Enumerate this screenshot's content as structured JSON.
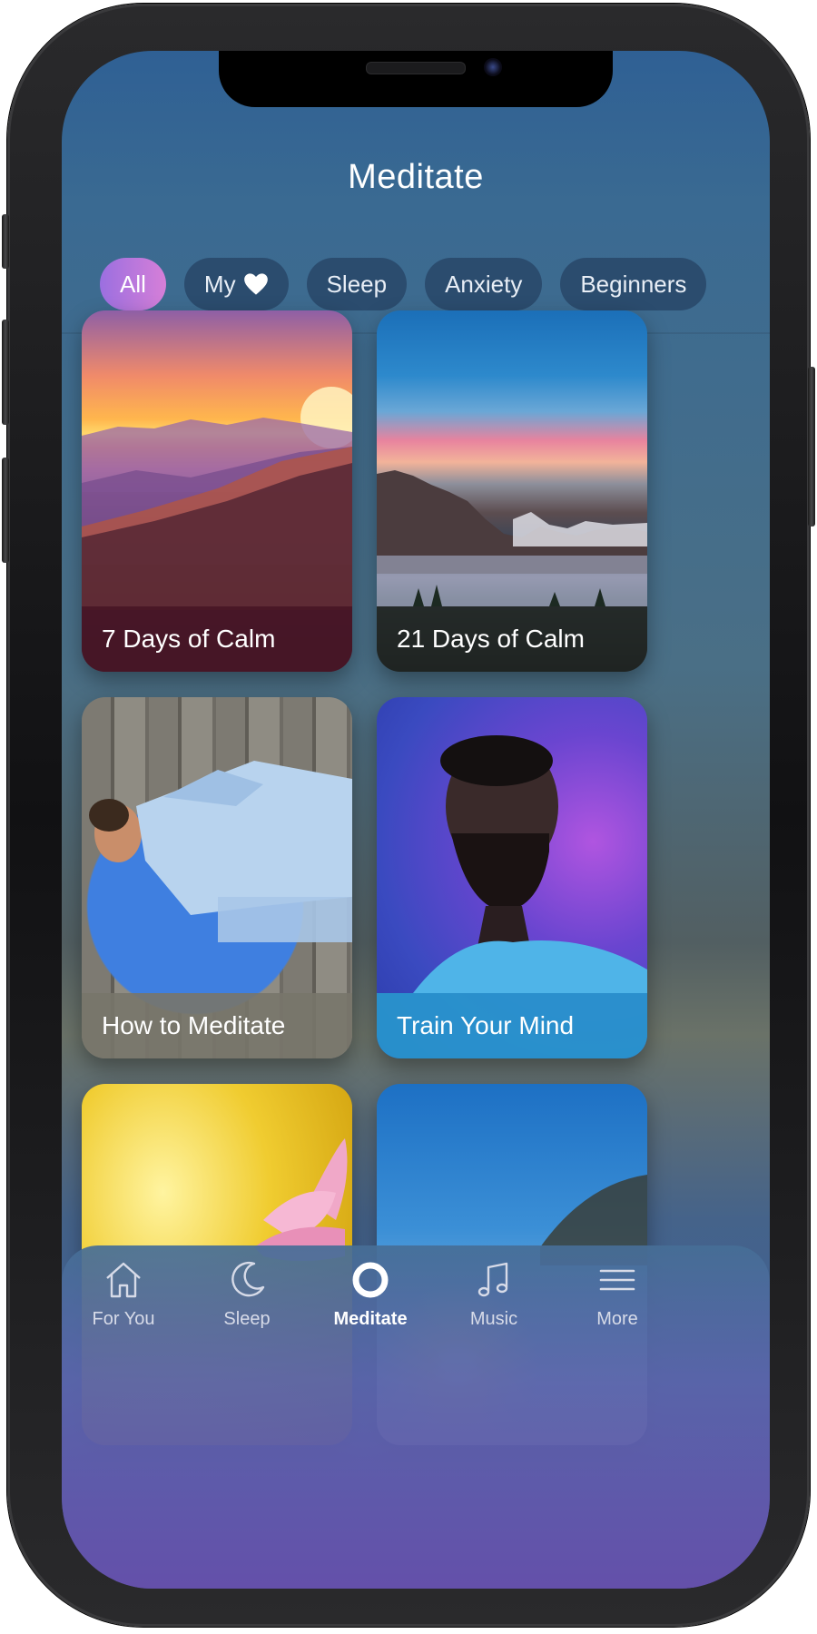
{
  "header": {
    "title": "Meditate"
  },
  "filters": [
    {
      "label": "All",
      "active": true
    },
    {
      "label": "My",
      "icon": "heart-icon",
      "active": false
    },
    {
      "label": "Sleep",
      "active": false
    },
    {
      "label": "Anxiety",
      "active": false
    },
    {
      "label": "Beginners",
      "active": false
    }
  ],
  "cards": [
    {
      "title": "7 Days of Calm",
      "art": "sunset-mountains",
      "label_color": "#3b1a26"
    },
    {
      "title": "21 Days of Calm",
      "art": "mountain-lake",
      "label_color": "#262b2a"
    },
    {
      "title": "How to Meditate",
      "art": "man-lying-on-dock",
      "label_color": "#7b7a70"
    },
    {
      "title": "Train Your Mind",
      "art": "man-eyes-closed",
      "label_color": "#2a8fc4"
    },
    {
      "title": "",
      "art": "lotus-flower"
    },
    {
      "title": "",
      "art": "ocean-sunrise"
    }
  ],
  "tabbar": {
    "items": [
      {
        "label": "For You",
        "icon": "home-icon",
        "active": false
      },
      {
        "label": "Sleep",
        "icon": "moon-icon",
        "active": false
      },
      {
        "label": "Meditate",
        "icon": "circle-icon",
        "active": true
      },
      {
        "label": "Music",
        "icon": "music-note-icon",
        "active": false
      },
      {
        "label": "More",
        "icon": "menu-icon",
        "active": false
      }
    ]
  },
  "colors": {
    "accent_gradient_start": "#9b6fe0",
    "accent_gradient_end": "#d67fd8",
    "screen_top": "#2f6094",
    "tab_active": "#ffffff",
    "tab_inactive": "#d7dbe8"
  }
}
